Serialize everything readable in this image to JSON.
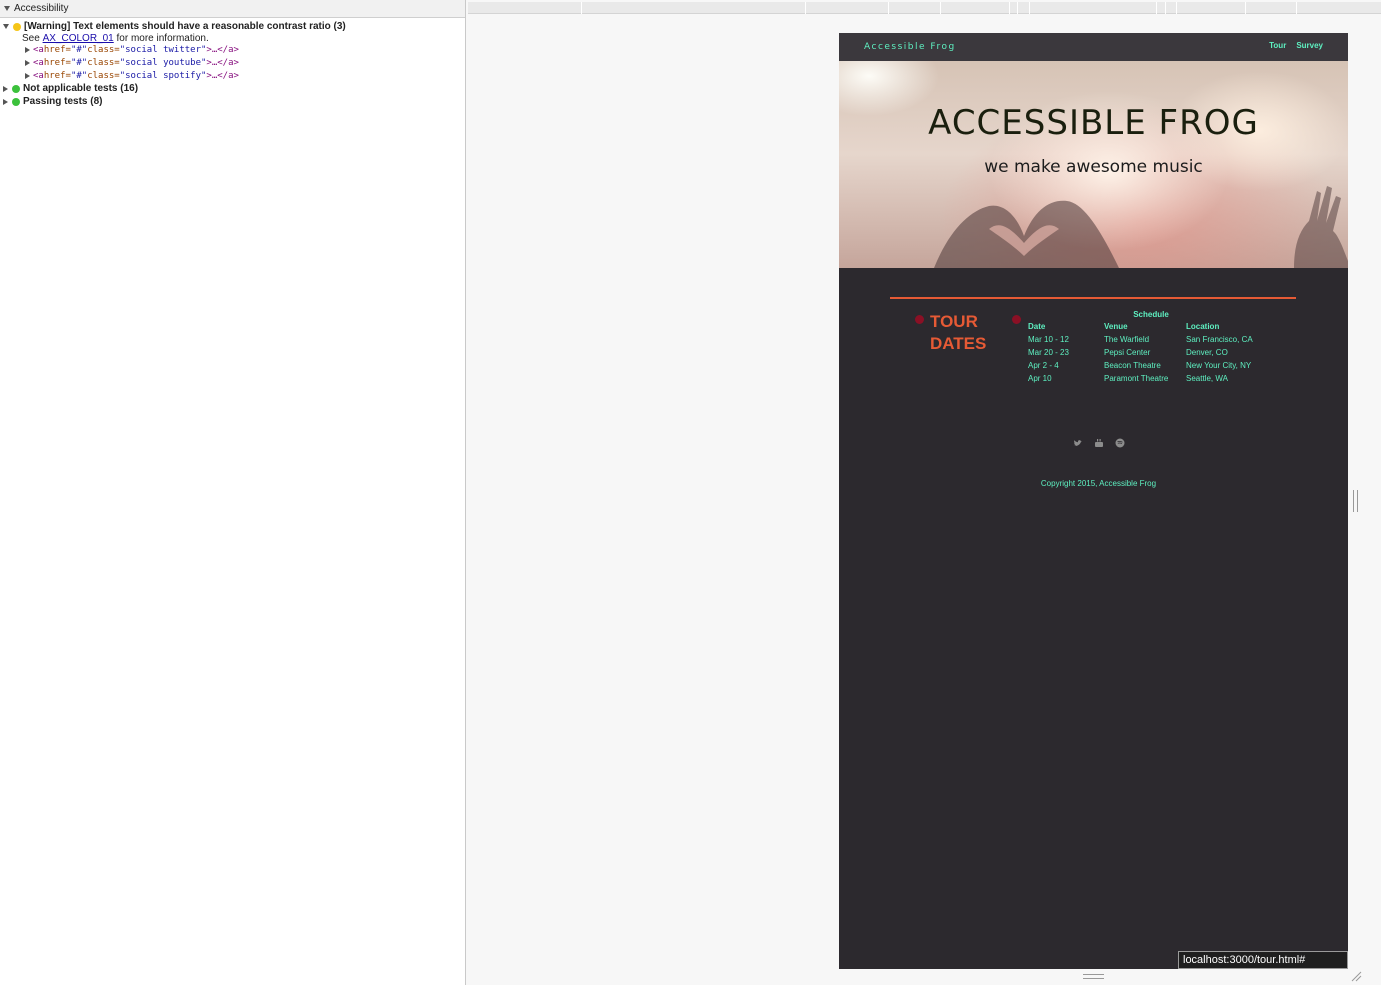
{
  "devtools": {
    "header": "Accessibility",
    "warning_label": "[Warning] Text elements should have a reasonable contrast ratio (3)",
    "see_prefix": "See",
    "see_link": "AX_COLOR_01",
    "see_suffix": "for more information.",
    "elements": [
      {
        "open": "<a ",
        "href_attr": "href=",
        "href_val": "\"#\"",
        "class_attr": " class=",
        "class_val": "\"social twitter\"",
        "close": ">…</a>"
      },
      {
        "open": "<a ",
        "href_attr": "href=",
        "href_val": "\"#\"",
        "class_attr": " class=",
        "class_val": "\"social youtube\"",
        "close": ">…</a>"
      },
      {
        "open": "<a ",
        "href_attr": "href=",
        "href_val": "\"#\"",
        "class_attr": " class=",
        "class_val": "\"social spotify\"",
        "close": ">…</a>"
      }
    ],
    "not_applicable": "Not applicable tests (16)",
    "passing": "Passing tests (8)",
    "colors": {
      "warning": "#f5c518",
      "pass": "#3cc13c"
    }
  },
  "site": {
    "brand": "Accessible Frog",
    "nav": [
      "Tour",
      "Survey"
    ],
    "hero_title": "ACCESSIBLE FROG",
    "hero_subtitle": "we make awesome music",
    "tour_title": "TOUR DATES",
    "schedule": {
      "caption": "Schedule",
      "headers": [
        "Date",
        "Venue",
        "Location"
      ],
      "rows": [
        [
          "Mar 10 - 12",
          "The Warfield",
          "San Francisco, CA"
        ],
        [
          "Mar 20 - 23",
          "Pepsi Center",
          "Denver, CO"
        ],
        [
          "Apr 2 - 4",
          "Beacon Theatre",
          "New Your City, NY"
        ],
        [
          "Apr 10",
          "Paramont Theatre",
          "Seattle, WA"
        ]
      ]
    },
    "social_icons": [
      "twitter-icon",
      "youtube-icon",
      "spotify-icon"
    ],
    "copyright": "Copyright 2015, Accessible Frog",
    "colors": {
      "accent": "#5ef0c1",
      "tour": "#e65a35",
      "background": "#2c292e"
    }
  },
  "status_url": "localhost:3000/tour.html#"
}
